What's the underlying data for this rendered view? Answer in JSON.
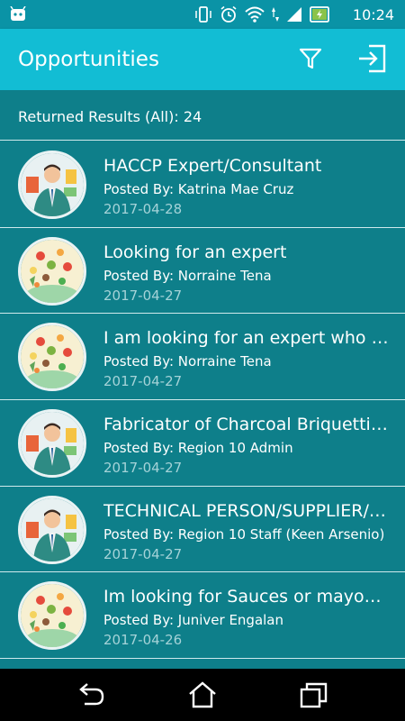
{
  "status_bar": {
    "time": "10:24"
  },
  "app_bar": {
    "title": "Opportunities",
    "filter_icon": "filter-icon",
    "exit_icon": "exit-icon"
  },
  "results": {
    "label": "Returned Results (All): 24"
  },
  "items": [
    {
      "title": "HACCP Expert/Consultant",
      "poster": "Posted By: Katrina Mae Cruz",
      "date": "2017-04-28",
      "avatar": "expert"
    },
    {
      "title": "Looking for an expert",
      "poster": "Posted By: Norraine Tena",
      "date": "2017-04-27",
      "avatar": "food"
    },
    {
      "title": "I am looking for an expert who ca…",
      "poster": "Posted By: Norraine Tena",
      "date": "2017-04-27",
      "avatar": "food"
    },
    {
      "title": "Fabricator of Charcoal Briquetting…",
      "poster": "Posted By: Region 10 Admin",
      "date": "2017-04-27",
      "avatar": "expert"
    },
    {
      "title": "TECHNICAL PERSON/SUPPLIER/…",
      "poster": "Posted By: Region 10 Staff (Keen Arsenio)",
      "date": "2017-04-27",
      "avatar": "expert"
    },
    {
      "title": "Im looking for Sauces or mayonn…",
      "poster": "Posted By: Juniver Engalan",
      "date": "2017-04-26",
      "avatar": "food"
    }
  ],
  "colors": {
    "primary": "#12bdd4",
    "background": "#0e7f8a",
    "date": "#a5d3d8"
  }
}
